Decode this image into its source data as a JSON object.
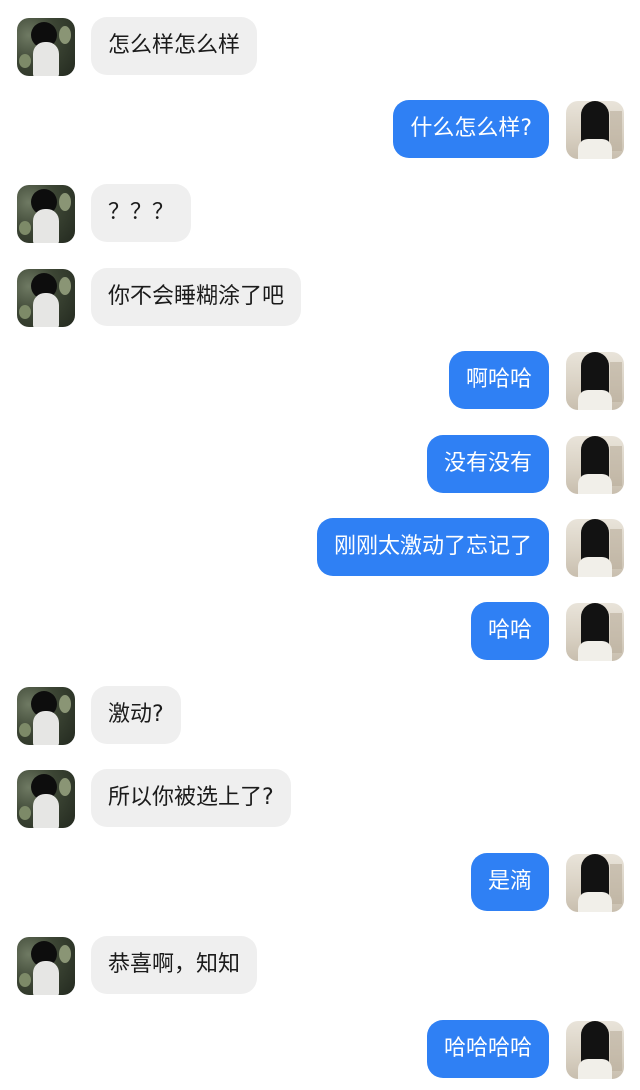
{
  "chat": {
    "accent_color": "#2f80f4",
    "incoming_bubble_color": "#efefef",
    "messages": [
      {
        "side": "left",
        "text": "怎么样怎么样"
      },
      {
        "side": "right",
        "text": "什么怎么样?"
      },
      {
        "side": "left",
        "text": "？？？"
      },
      {
        "side": "left",
        "text": "你不会睡糊涂了吧"
      },
      {
        "side": "right",
        "text": "啊哈哈"
      },
      {
        "side": "right",
        "text": "没有没有"
      },
      {
        "side": "right",
        "text": "刚刚太激动了忘记了"
      },
      {
        "side": "right",
        "text": "哈哈"
      },
      {
        "side": "left",
        "text": "激动?"
      },
      {
        "side": "left",
        "text": "所以你被选上了?"
      },
      {
        "side": "right",
        "text": "是滴"
      },
      {
        "side": "left",
        "text": "恭喜啊，知知"
      },
      {
        "side": "right",
        "text": "哈哈哈哈"
      }
    ]
  }
}
